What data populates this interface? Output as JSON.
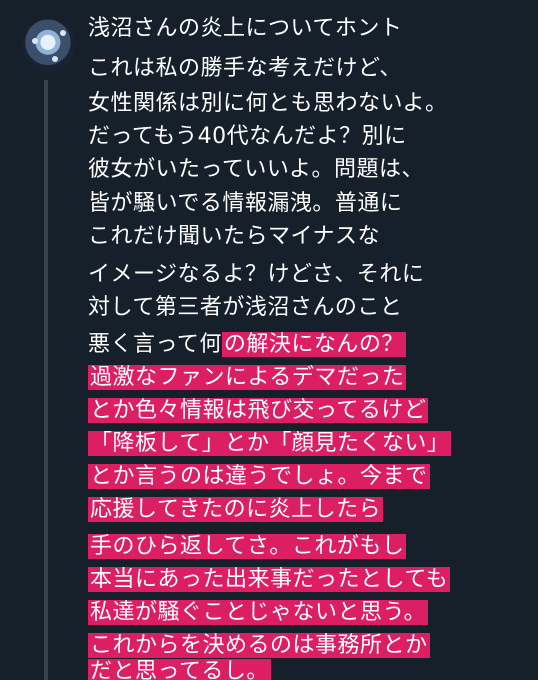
{
  "tweet": {
    "lines": [
      {
        "plain": "浅沼さんの炎上についてホント",
        "highlight": ""
      },
      {
        "plain": "これは私の勝手な考えだけど、",
        "highlight": ""
      },
      {
        "plain": "女性関係は別に何とも思わないよ。",
        "highlight": ""
      },
      {
        "plain": "だってもう40代なんだよ？別に",
        "highlight": ""
      },
      {
        "plain": "彼女がいたっていいよ。問題は、",
        "highlight": ""
      },
      {
        "plain": "皆が騒いでる情報漏洩。普通に",
        "highlight": ""
      },
      {
        "plain": "これだけ聞いたらマイナスな",
        "highlight": ""
      },
      {
        "plain": "イメージなるよ？けどさ、それに",
        "highlight": ""
      },
      {
        "plain": "対して第三者が浅沼さんのこと",
        "highlight": ""
      },
      {
        "plain": "悪く言って何",
        "highlight": "の解決になんの？"
      },
      {
        "plain": "",
        "highlight": "過激なファンによるデマだった"
      },
      {
        "plain": "",
        "highlight": "とか色々情報は飛び交ってるけど"
      },
      {
        "plain": "",
        "highlight": "「降板して」とか「顔見たくない」"
      },
      {
        "plain": "",
        "highlight": "とか言うのは違うでしょ。今まで"
      },
      {
        "plain": "",
        "highlight": "応援してきたのに炎上したら"
      },
      {
        "plain": "",
        "highlight": "手のひら返してさ。これがもし"
      },
      {
        "plain": "",
        "highlight": "本当にあった出来事だったとしても"
      },
      {
        "plain": "",
        "highlight": "私達が騒ぐことじゃないと思う。"
      },
      {
        "plain": "",
        "highlight": "これからを決めるのは事務所とか"
      },
      {
        "plain": "",
        "highlight": "だと思ってるし。"
      }
    ]
  },
  "colors": {
    "background": "#15202b",
    "text": "#ffffff",
    "highlight": "#dc1e63",
    "thread_line": "#38444d"
  },
  "icons": {
    "avatar": "user-avatar-image"
  }
}
